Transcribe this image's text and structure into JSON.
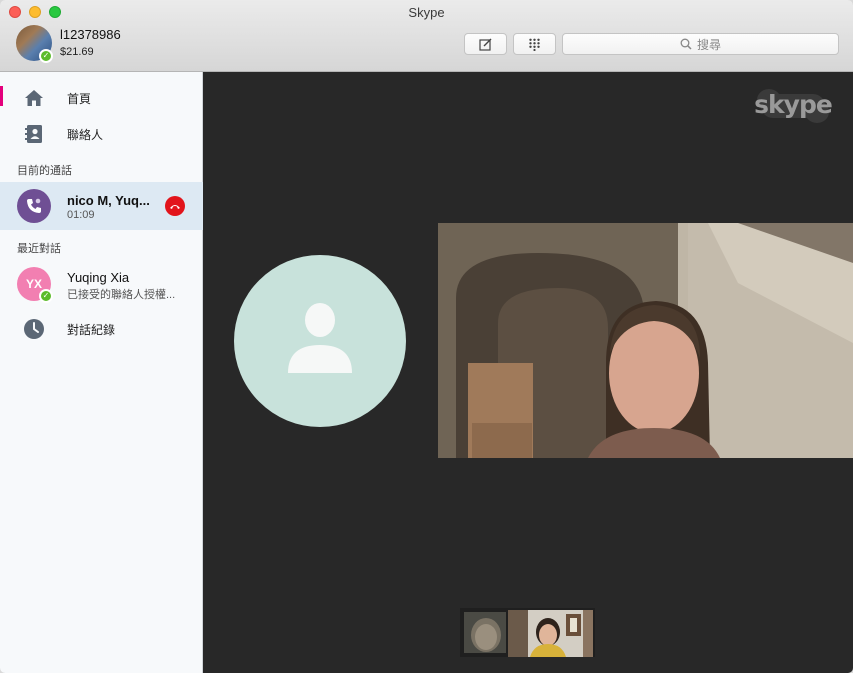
{
  "window": {
    "title": "Skype"
  },
  "profile": {
    "username": "l12378986",
    "credit": "$21.69",
    "status_color": "#5bbb2b"
  },
  "toolbar": {
    "compose_icon": "compose-icon",
    "dialpad_icon": "dialpad-icon",
    "search_placeholder": "搜尋"
  },
  "sidebar": {
    "nav": [
      {
        "label": "首頁",
        "icon": "home-icon"
      },
      {
        "label": "聯絡人",
        "icon": "contacts-icon"
      }
    ],
    "current_calls_title": "目前的通話",
    "current_call": {
      "name": "nico M, Yuq...",
      "duration": "01:09",
      "avatar_color": "#6f4f94",
      "hangup_color": "#e2141b"
    },
    "recent_title": "最近對話",
    "recent": [
      {
        "initials": "YX",
        "name": "Yuqing Xia",
        "preview": "已接受的聯絡人授權...",
        "avatar_color": "#f27fb1"
      }
    ],
    "history": {
      "label": "對話紀錄",
      "icon": "clock-icon"
    }
  },
  "stage": {
    "background": "#282828",
    "logo_text": "skype",
    "placeholder_color": "#c8e2db"
  }
}
